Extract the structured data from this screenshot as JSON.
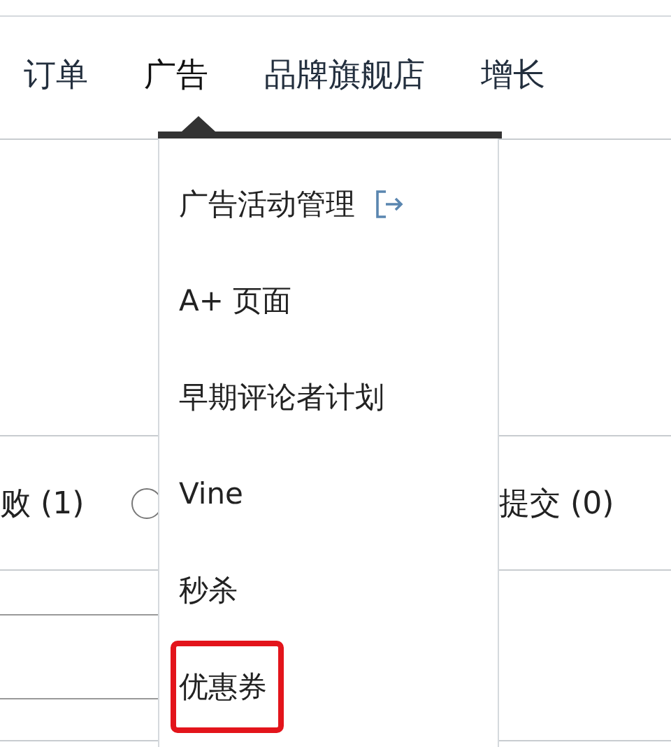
{
  "tabs": [
    {
      "label": "订单",
      "selected": false
    },
    {
      "label": "广告",
      "selected": true
    },
    {
      "label": "品牌旗舰店",
      "selected": false
    },
    {
      "label": "增长",
      "selected": false
    }
  ],
  "menu": {
    "items": [
      {
        "label": "广告活动管理",
        "kind": "external",
        "highlighted": false
      },
      {
        "label": "A+ 页面",
        "kind": "plain",
        "highlighted": false
      },
      {
        "label": "早期评论者计划",
        "kind": "plain",
        "highlighted": false
      },
      {
        "label": "Vine",
        "kind": "plain",
        "highlighted": false
      },
      {
        "label": "秒杀",
        "kind": "plain",
        "highlighted": false
      },
      {
        "label": "优惠券",
        "kind": "plain",
        "highlighted": true
      }
    ]
  },
  "filters": [
    {
      "label": "败 (1)"
    },
    {
      "label": "提交 (0)"
    }
  ],
  "radio": {
    "selected": false
  }
}
